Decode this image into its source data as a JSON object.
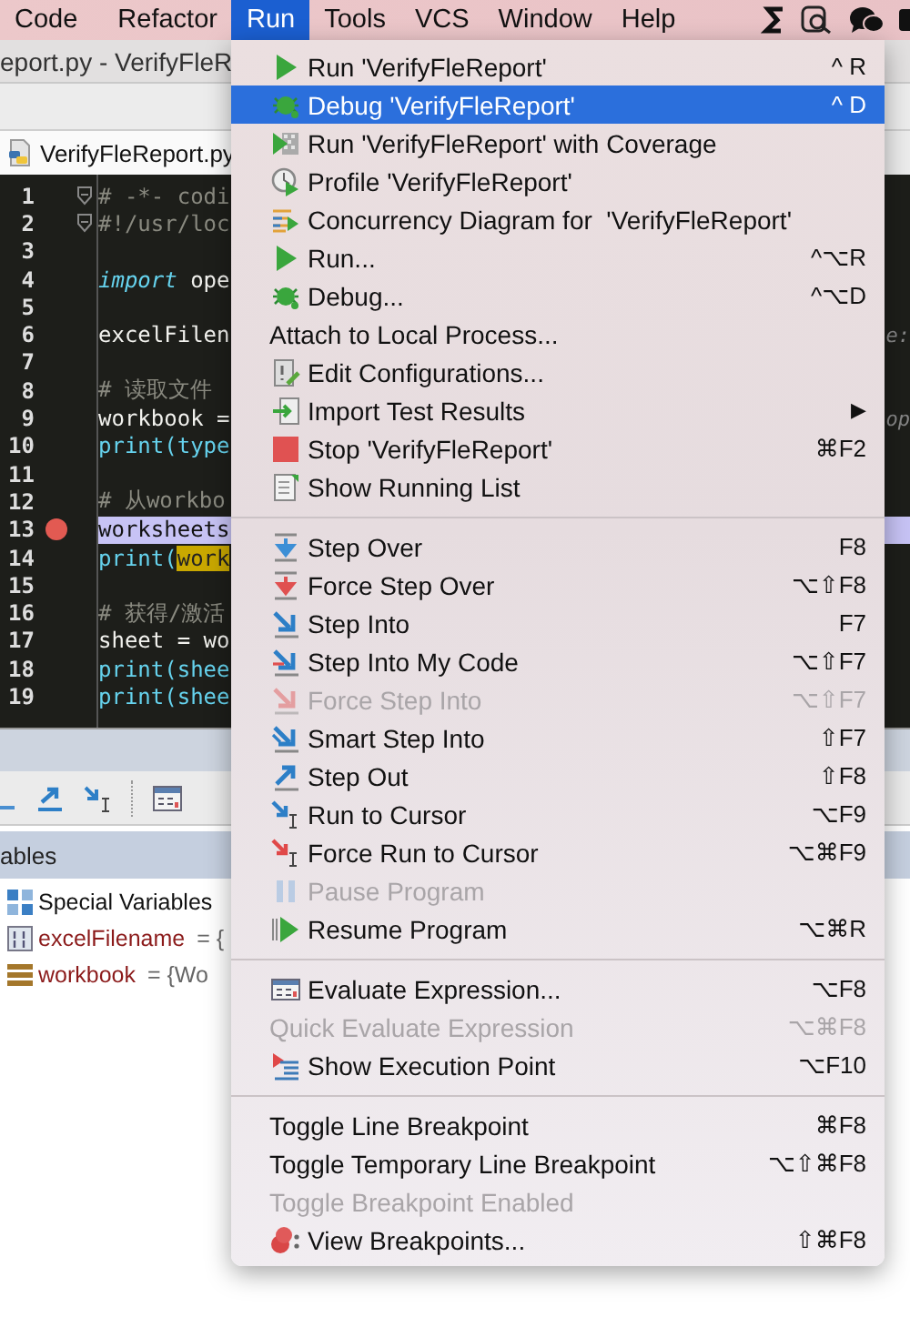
{
  "menubar": {
    "items": [
      {
        "label": "Code",
        "selected": false
      },
      {
        "label": "Refactor",
        "selected": false
      },
      {
        "label": "Run",
        "selected": true
      },
      {
        "label": "Tools",
        "selected": false
      },
      {
        "label": "VCS",
        "selected": false
      },
      {
        "label": "Window",
        "selected": false
      },
      {
        "label": "Help",
        "selected": false
      }
    ]
  },
  "window": {
    "title": "eport.py - VerifyFleR"
  },
  "editor_tab": {
    "label": "VerifyFleReport.py"
  },
  "editor": {
    "lines": [
      {
        "number": "1",
        "fold": true,
        "breakpoint": false,
        "current": false,
        "segments": [
          {
            "kind": "comment",
            "text": "# -*- codi"
          }
        ]
      },
      {
        "number": "2",
        "fold": true,
        "breakpoint": false,
        "current": false,
        "segments": [
          {
            "kind": "comment",
            "text": "#!/usr/loc"
          }
        ]
      },
      {
        "number": "3",
        "fold": false,
        "breakpoint": false,
        "current": false
      },
      {
        "number": "4",
        "fold": false,
        "breakpoint": false,
        "current": false,
        "segments": [
          {
            "kind": "keyword",
            "text": "import"
          },
          {
            "kind": "plain",
            "text": " ope"
          }
        ]
      },
      {
        "number": "5",
        "fold": false,
        "breakpoint": false,
        "current": false
      },
      {
        "number": "6",
        "fold": false,
        "breakpoint": false,
        "current": false,
        "segments": [
          {
            "kind": "plain",
            "text": "excelFilen"
          }
        ],
        "hint": "e:"
      },
      {
        "number": "7",
        "fold": false,
        "breakpoint": false,
        "current": false
      },
      {
        "number": "8",
        "fold": false,
        "breakpoint": false,
        "current": false,
        "segments": [
          {
            "kind": "comment",
            "text": "# 读取文件"
          }
        ]
      },
      {
        "number": "9",
        "fold": false,
        "breakpoint": false,
        "current": false,
        "segments": [
          {
            "kind": "plain",
            "text": "workbook ="
          }
        ],
        "hint": "op"
      },
      {
        "number": "10",
        "fold": false,
        "breakpoint": false,
        "current": false,
        "segments": [
          {
            "kind": "builtin",
            "text": "print(type"
          }
        ]
      },
      {
        "number": "11",
        "fold": false,
        "breakpoint": false,
        "current": false
      },
      {
        "number": "12",
        "fold": false,
        "breakpoint": false,
        "current": false,
        "segments": [
          {
            "kind": "comment",
            "text": "# 从workbo"
          }
        ]
      },
      {
        "number": "13",
        "fold": false,
        "breakpoint": true,
        "current": true,
        "segments": [
          {
            "kind": "plain",
            "text": "worksheets"
          }
        ]
      },
      {
        "number": "14",
        "fold": false,
        "breakpoint": false,
        "current": false,
        "segments": [
          {
            "kind": "builtin",
            "text": "print("
          },
          {
            "kind": "match",
            "text": "work"
          }
        ]
      },
      {
        "number": "15",
        "fold": false,
        "breakpoint": false,
        "current": false
      },
      {
        "number": "16",
        "fold": false,
        "breakpoint": false,
        "current": false,
        "segments": [
          {
            "kind": "comment",
            "text": "# 获得/激活"
          }
        ]
      },
      {
        "number": "17",
        "fold": false,
        "breakpoint": false,
        "current": false,
        "segments": [
          {
            "kind": "plain",
            "text": "sheet = wo"
          }
        ]
      },
      {
        "number": "18",
        "fold": false,
        "breakpoint": false,
        "current": false,
        "segments": [
          {
            "kind": "builtin",
            "text": "print(shee"
          }
        ]
      },
      {
        "number": "19",
        "fold": false,
        "breakpoint": false,
        "current": false,
        "segments": [
          {
            "kind": "builtin",
            "text": "print(shee"
          }
        ]
      }
    ]
  },
  "debugger": {
    "header": "ables",
    "variables": [
      {
        "kind": "group",
        "name": "Special Variables"
      },
      {
        "kind": "variable",
        "name": "excelFilename",
        "value": " = {"
      },
      {
        "kind": "variable",
        "name": "workbook",
        "value": " = {Wo"
      }
    ]
  },
  "run_menu": {
    "sections": [
      [
        {
          "label": "Run 'VerifyFleReport'",
          "shortcut": "^ R",
          "disabled": false,
          "selected": false
        },
        {
          "label": "Debug 'VerifyFleReport'",
          "shortcut": "^ D",
          "disabled": false,
          "selected": true
        },
        {
          "label": "Run 'VerifyFleReport' with Coverage",
          "disabled": false,
          "selected": false
        },
        {
          "label": "Profile 'VerifyFleReport'",
          "disabled": false,
          "selected": false
        },
        {
          "label": "Concurrency Diagram for  'VerifyFleReport'",
          "disabled": false,
          "selected": false
        },
        {
          "label": "Run...",
          "shortcut": "^⌥R",
          "disabled": false,
          "selected": false
        },
        {
          "label": "Debug...",
          "shortcut": "^⌥D",
          "disabled": false,
          "selected": false
        },
        {
          "label": "Attach to Local Process...",
          "disabled": false,
          "selected": false
        },
        {
          "label": "Edit Configurations...",
          "disabled": false,
          "selected": false
        },
        {
          "label": "Import Test Results",
          "submenu": "▶",
          "disabled": false,
          "selected": false
        },
        {
          "label": "Stop 'VerifyFleReport'",
          "shortcut": "⌘F2",
          "disabled": false,
          "selected": false
        },
        {
          "label": "Show Running List",
          "disabled": false,
          "selected": false
        }
      ],
      [
        {
          "label": "Step Over",
          "shortcut": "F8",
          "disabled": false,
          "selected": false
        },
        {
          "label": "Force Step Over",
          "shortcut": "⌥⇧F8",
          "disabled": false,
          "selected": false
        },
        {
          "label": "Step Into",
          "shortcut": "F7",
          "disabled": false,
          "selected": false
        },
        {
          "label": "Step Into My Code",
          "shortcut": "⌥⇧F7",
          "disabled": false,
          "selected": false
        },
        {
          "label": "Force Step Into",
          "shortcut": "⌥⇧F7",
          "disabled": true,
          "selected": false
        },
        {
          "label": "Smart Step Into",
          "shortcut": "⇧F7",
          "disabled": false,
          "selected": false
        },
        {
          "label": "Step Out",
          "shortcut": "⇧F8",
          "disabled": false,
          "selected": false
        },
        {
          "label": "Run to Cursor",
          "shortcut": "⌥F9",
          "disabled": false,
          "selected": false
        },
        {
          "label": "Force Run to Cursor",
          "shortcut": "⌥⌘F9",
          "disabled": false,
          "selected": false
        },
        {
          "label": "Pause Program",
          "disabled": true,
          "selected": false
        },
        {
          "label": "Resume Program",
          "shortcut": "⌥⌘R",
          "disabled": false,
          "selected": false
        }
      ],
      [
        {
          "label": "Evaluate Expression...",
          "shortcut": "⌥F8",
          "disabled": false,
          "selected": false
        },
        {
          "label": "Quick Evaluate Expression",
          "shortcut": "⌥⌘F8",
          "disabled": true,
          "selected": false
        },
        {
          "label": "Show Execution Point",
          "shortcut": "⌥F10",
          "disabled": false,
          "selected": false
        }
      ],
      [
        {
          "label": "Toggle Line Breakpoint",
          "shortcut": "⌘F8",
          "disabled": false,
          "selected": false
        },
        {
          "label": "Toggle Temporary Line Breakpoint",
          "shortcut": "⌥⇧⌘F8",
          "disabled": false,
          "selected": false
        },
        {
          "label": "Toggle Breakpoint Enabled",
          "disabled": true,
          "selected": false
        },
        {
          "label": "View Breakpoints...",
          "shortcut": "⇧⌘F8",
          "disabled": false,
          "selected": false
        }
      ]
    ]
  }
}
